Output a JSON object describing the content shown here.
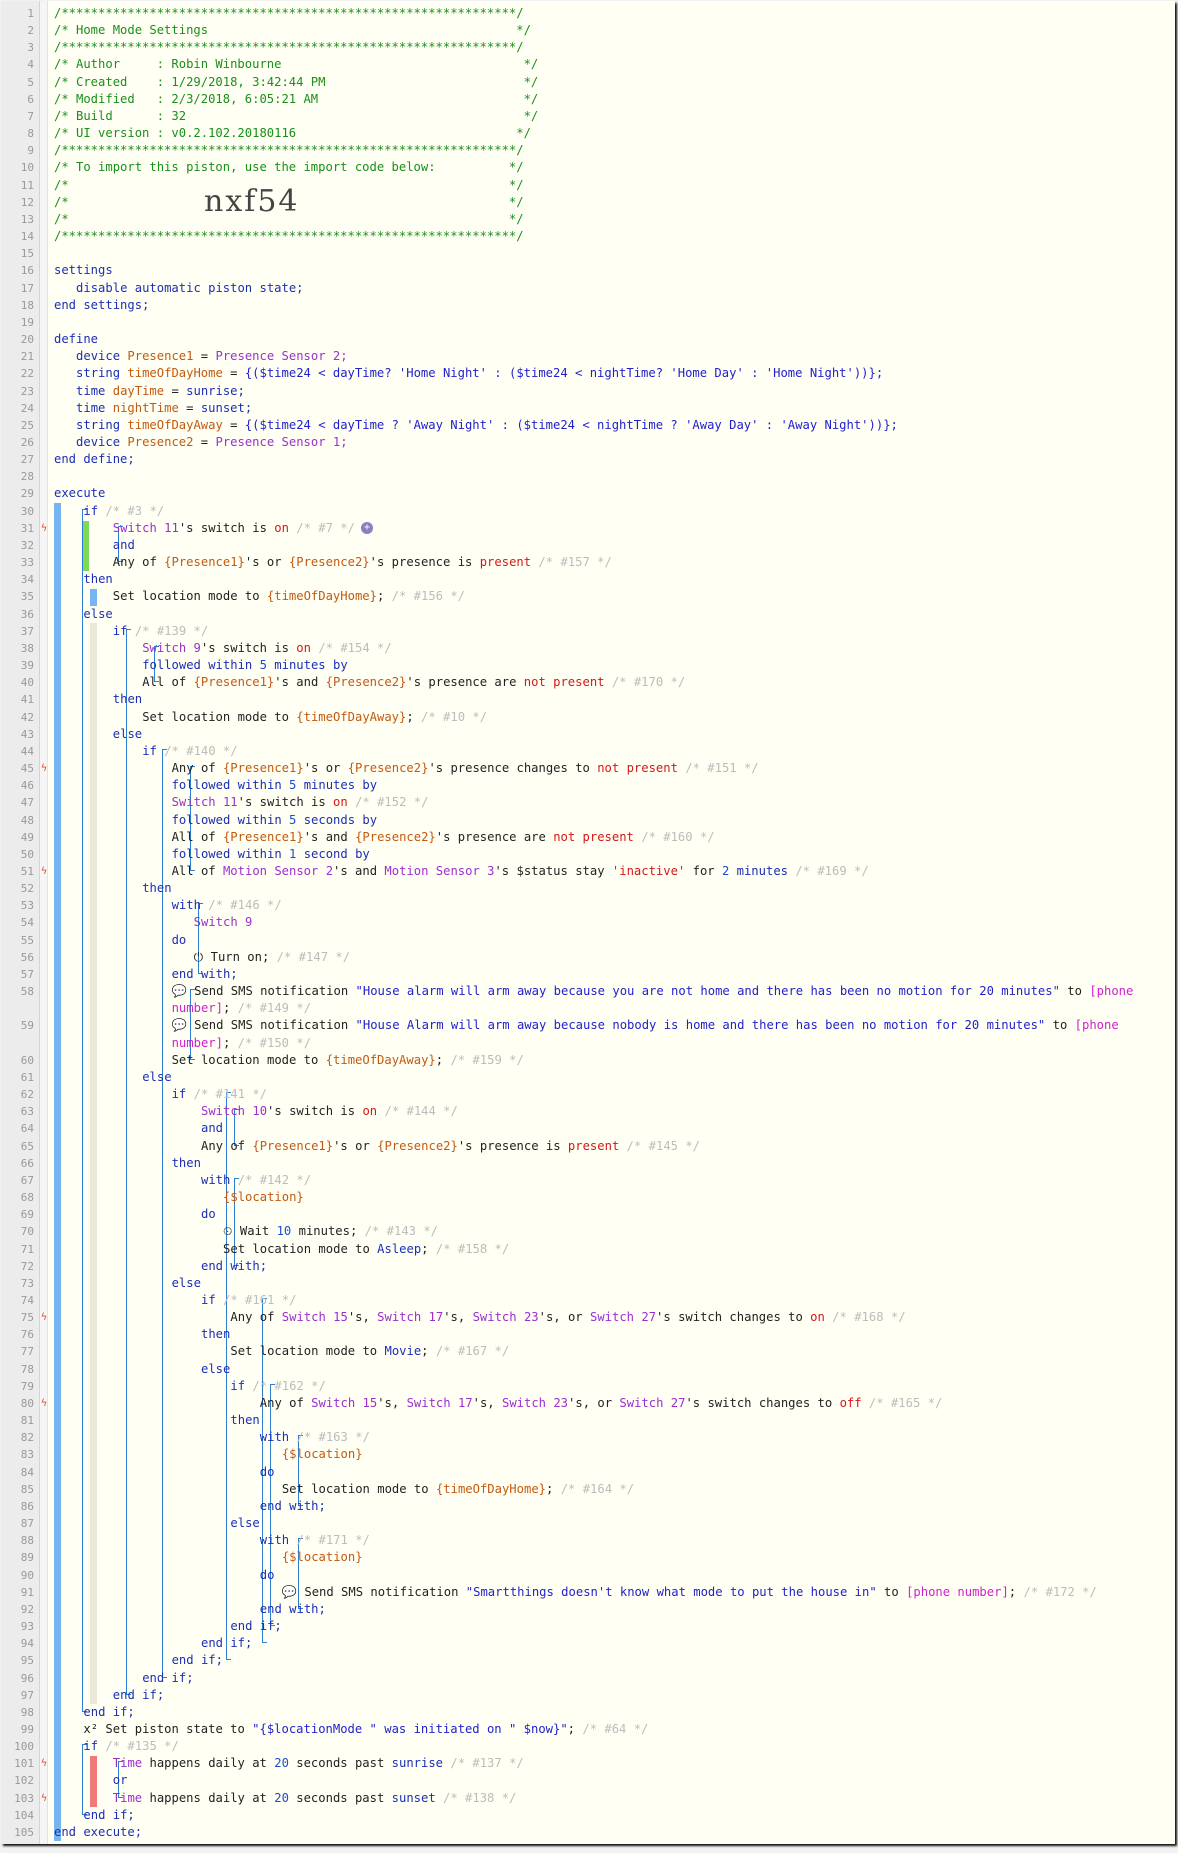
{
  "window": {
    "title": "Home Mode Settings"
  },
  "header": {
    "title_line": "/* Home Mode Settings                                          */",
    "author_line": "/* Author     : Robin Winbourne                                 */",
    "created_line": "/* Created    : 1/29/2018, 3:42:44 PM                           */",
    "modified_line": "/* Modified   : 2/3/2018, 6:05:21 AM                            */",
    "build_line": "/* Build      : 32                                              */",
    "ui_line": "/* UI version : v0.2.102.20180116                              */",
    "import_line": "/* To import this piston, use the import code below:          */",
    "slash_line": "/*                                                            */",
    "import_code": "nxf54",
    "stars": "/**************************************************************/"
  },
  "settings": {
    "open": "settings",
    "item": "disable automatic piston state;",
    "close": "end settings;"
  },
  "define": {
    "open": "define",
    "close": "end define;",
    "vars": [
      {
        "type": "device",
        "name": "Presence1",
        "value": "Presence Sensor 2;"
      },
      {
        "type": "string",
        "name": "timeOfDayHome",
        "value": "{($time24 < dayTime? 'Home Night' : ($time24 < nightTime? 'Home Day' : 'Home Night'))};"
      },
      {
        "type": "time",
        "name": "dayTime",
        "value": "sunrise;"
      },
      {
        "type": "time",
        "name": "nightTime",
        "value": "sunset;"
      },
      {
        "type": "string",
        "name": "timeOfDayAway",
        "value": "{($time24 < dayTime ? 'Away Night' : ($time24 < nightTime ? 'Away Day' : 'Away Night'))};"
      },
      {
        "type": "device",
        "name": "Presence2",
        "value": "Presence Sensor 1;"
      }
    ]
  },
  "kw": {
    "execute": "execute",
    "end_execute": "end execute;",
    "if": "if",
    "then": "then",
    "else": "else",
    "and": "and",
    "or": "or",
    "do": "do",
    "with": "with",
    "end_if": "end if;",
    "end_with": "end with;",
    "followed": "followed within",
    "by": "by"
  },
  "code": {
    "c3": "/* #3 */",
    "l31": [
      "Switch 11",
      "'s ",
      "switch",
      " is ",
      "on",
      " /* #7 */"
    ],
    "l33": [
      "Any of ",
      "{Presence1}",
      "'s or ",
      "{Presence2}",
      "'s ",
      "presence",
      " is ",
      "present",
      " /* #157 */"
    ],
    "l35": [
      "Set location mode to ",
      "{timeOfDayHome}",
      "; ",
      "/* #156 */"
    ],
    "c139": "/* #139 */",
    "l38": [
      "Switch 9",
      "'s ",
      "switch",
      " is ",
      "on",
      " /* #154 */"
    ],
    "l39": [
      "5",
      "minutes"
    ],
    "l40": [
      "All of ",
      "{Presence1}",
      "'s and ",
      "{Presence2}",
      "'s ",
      "presence",
      " are ",
      "not present",
      " /* #170 */"
    ],
    "l42": [
      "Set location mode to ",
      "{timeOfDayAway}",
      "; ",
      "/* #10 */"
    ],
    "c140": "/* #140 */",
    "l45": [
      "Any of ",
      "{Presence1}",
      "'s or ",
      "{Presence2}",
      "'s ",
      "presence",
      " changes to ",
      "not present",
      " /* #151 */"
    ],
    "l46": [
      "5",
      "minutes"
    ],
    "l47": [
      "Switch 11",
      "'s ",
      "switch",
      " is ",
      "on",
      " /* #152 */"
    ],
    "l48": [
      "5",
      "seconds"
    ],
    "l49": [
      "All of ",
      "{Presence1}",
      "'s and ",
      "{Presence2}",
      "'s ",
      "presence",
      " are ",
      "not present",
      " /* #160 */"
    ],
    "l50": [
      "1",
      "second"
    ],
    "l51": [
      "All of ",
      "Motion Sensor 2",
      "'s and ",
      "Motion Sensor 3",
      "'s ",
      "$status",
      " stay ",
      "'inactive'",
      " for ",
      "2",
      " minutes",
      " /* #169 */"
    ],
    "c146": "/* #146 */",
    "l54": "Switch 9",
    "l56": [
      "Turn on; ",
      "/* #147 */"
    ],
    "l58a": [
      "Send SMS notification ",
      "\"House alarm will arm away because you are not home and there has been no motion for 20 minutes\"",
      " to ",
      "[phone"
    ],
    "l58b": [
      "number]",
      "; ",
      "/* #149 */"
    ],
    "l59a": [
      "Send SMS notification ",
      "\"House Alarm will arm away because nobody is home and there has been no motion for 20 minutes\"",
      " to ",
      "[phone"
    ],
    "l59b": [
      "number]",
      "; ",
      "/* #150 */"
    ],
    "l60": [
      "Set location mode to ",
      "{timeOfDayAway}",
      "; ",
      "/* #159 */"
    ],
    "c141": "/* #141 */",
    "l63": [
      "Switch 10",
      "'s ",
      "switch",
      " is ",
      "on",
      " /* #144 */"
    ],
    "l65": [
      "Any of ",
      "{Presence1}",
      "'s or ",
      "{Presence2}",
      "'s ",
      "presence",
      " is ",
      "present",
      " /* #145 */"
    ],
    "c142": "/* #142 */",
    "loc": "{$location}",
    "l70": [
      "Wait ",
      "10",
      " minutes; ",
      "/* #143 */"
    ],
    "l71": [
      "Set location mode to ",
      "Asleep",
      "; ",
      "/* #158 */"
    ],
    "c161": "/* #161 */",
    "l75": [
      "Any of ",
      "Switch 15",
      "'s, ",
      "Switch 17",
      "'s, ",
      "Switch 23",
      "'s, or ",
      "Switch 27",
      "'s ",
      "switch",
      " changes to ",
      "on",
      " /* #168 */"
    ],
    "l77": [
      "Set location mode to ",
      "Movie",
      "; ",
      "/* #167 */"
    ],
    "c162": "/* #162 */",
    "l80": [
      "Any of ",
      "Switch 15",
      "'s, ",
      "Switch 17",
      "'s, ",
      "Switch 23",
      "'s, or ",
      "Switch 27",
      "'s ",
      "switch",
      " changes to ",
      "off",
      " /* #165 */"
    ],
    "c163": "/* #163 */",
    "l85": [
      "Set location mode to ",
      "{timeOfDayHome}",
      "; ",
      "/* #164 */"
    ],
    "c171": "/* #171 */",
    "l91": [
      "Send SMS notification ",
      "\"Smartthings doesn't know what mode to put the house in\"",
      " to ",
      "[phone number]",
      "; ",
      "/* #172 */"
    ],
    "l99": [
      "Set piston state to ",
      "\"{$locationMode \" was initiated on \" $now}\"",
      "; ",
      "/* #64 */"
    ],
    "c135": "/* #135 */",
    "l101": [
      "Time",
      " happens daily at ",
      "20",
      " seconds past ",
      "sunrise",
      " /* #137 */"
    ],
    "l103": [
      "Time",
      " happens daily at ",
      "20",
      " seconds past ",
      "sunset",
      " /* #138 */"
    ]
  },
  "colors": {
    "green_bar": "#7ed957",
    "blue_bar": "#77b5f0",
    "red_bar": "#f07a7a",
    "bracket": "#2d7fd4"
  }
}
